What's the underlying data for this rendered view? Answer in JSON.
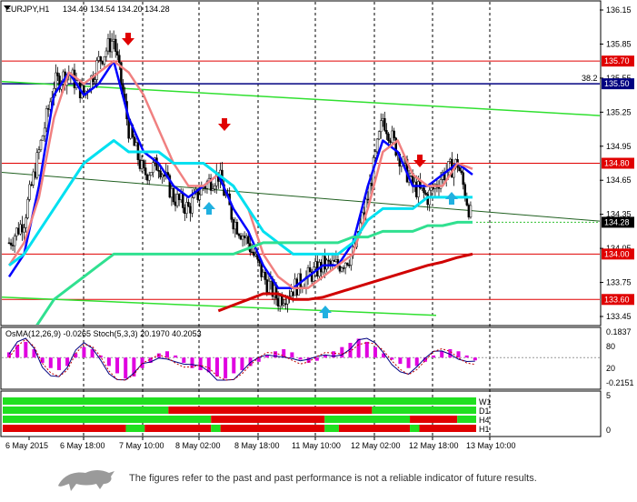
{
  "header": {
    "symbol": "EURJPY,H1",
    "ohlc": "134.49 134.54 134.20 134.28"
  },
  "colors": {
    "ma_fast": "#0000ff",
    "ma_mid": "#f08080",
    "ma_cyan": "#00e0f0",
    "ma_green": "#30e090",
    "ma_red": "#d00000",
    "trend": "#30e030",
    "level": "#e00000",
    "resistance": "#000080"
  },
  "chart_data": [
    {
      "type": "line",
      "ylim": [
        133.45,
        136.15
      ],
      "yticks": [
        "136.15",
        "135.85",
        "135.55",
        "135.25",
        "134.95",
        "134.65",
        "134.35",
        "134.05",
        "133.75",
        "133.45"
      ],
      "x": [
        "6 May 2015",
        "6 May 18:00",
        "7 May 10:00",
        "8 May 02:00",
        "8 May 18:00",
        "11 May 10:00",
        "12 May 02:00",
        "12 May 18:00",
        "13 May 10:00"
      ],
      "levels": [
        "135.70",
        "135.50",
        "134.80",
        "134.00",
        "133.60"
      ],
      "last_price": "134.28",
      "fib_label": "38.2",
      "series": [
        {
          "values": [
            134.1,
            134.3,
            134.9,
            135.5,
            135.6,
            135.4,
            135.7,
            135.9,
            135.1,
            134.7,
            134.8,
            134.5,
            134.4,
            134.6,
            134.7,
            134.3,
            134.1,
            133.8,
            133.6,
            133.7,
            133.8,
            133.9,
            133.9,
            134.0,
            134.5,
            135.2,
            134.9,
            134.6,
            134.5,
            134.7,
            134.8,
            134.28
          ]
        },
        {
          "values": [
            133.8,
            134.0,
            134.6,
            135.4,
            135.6,
            135.4,
            135.5,
            135.7,
            135.2,
            134.9,
            134.8,
            134.6,
            134.5,
            134.6,
            134.7,
            134.4,
            134.2,
            133.9,
            133.7,
            133.7,
            133.8,
            133.9,
            133.9,
            134.1,
            134.6,
            135.0,
            134.9,
            134.6,
            134.6,
            134.7,
            134.8,
            134.7
          ]
        },
        {
          "values": [
            133.9,
            134.1,
            134.5,
            135.2,
            135.6,
            135.5,
            135.6,
            135.7,
            135.6,
            135.4,
            135.1,
            134.8,
            134.6,
            134.6,
            134.7,
            134.6,
            134.4,
            134.0,
            133.8,
            133.7,
            133.7,
            133.8,
            133.9,
            134.0,
            134.4,
            134.9,
            135.0,
            134.7,
            134.6,
            134.6,
            134.8,
            134.75
          ]
        },
        {
          "values": [
            133.9,
            134.0,
            134.2,
            134.4,
            134.6,
            134.8,
            134.9,
            135.0,
            134.9,
            134.9,
            134.9,
            134.8,
            134.8,
            134.8,
            134.7,
            134.6,
            134.4,
            134.2,
            134.1,
            134.0,
            134.0,
            134.0,
            134.0,
            134.1,
            134.3,
            134.4,
            134.4,
            134.4,
            134.5,
            134.5,
            134.5,
            134.5
          ]
        },
        {
          "values": [
            133.0,
            133.2,
            133.4,
            133.6,
            133.7,
            133.8,
            133.9,
            134.0,
            134.0,
            134.0,
            134.0,
            134.0,
            134.0,
            134.0,
            134.0,
            134.0,
            134.05,
            134.1,
            134.1,
            134.1,
            134.1,
            134.1,
            134.1,
            134.15,
            134.15,
            134.2,
            134.2,
            134.2,
            134.25,
            134.25,
            134.28,
            134.28
          ]
        },
        {
          "values": [
            null,
            null,
            null,
            null,
            null,
            null,
            null,
            null,
            null,
            null,
            null,
            null,
            null,
            null,
            133.5,
            133.55,
            133.6,
            133.65,
            133.65,
            133.6,
            133.6,
            133.62,
            133.66,
            133.7,
            133.74,
            133.78,
            133.82,
            133.86,
            133.9,
            133.93,
            133.97,
            134.0
          ]
        }
      ]
    },
    {
      "type": "bar",
      "title": "OsMA(12,26,9) -0.0265  Stoch(5,3,3) 20.1970 40.2053",
      "yticks": [
        "0.1837",
        "80",
        "20",
        "-0.2151"
      ],
      "values": [
        0.05,
        0.12,
        0.15,
        0.08,
        -0.05,
        -0.1,
        -0.12,
        -0.08,
        0.04,
        0.1,
        0.08,
        0.02,
        -0.08,
        -0.15,
        -0.2,
        -0.18,
        -0.1,
        -0.05,
        0.04,
        0.06,
        0.02,
        -0.05,
        -0.1,
        -0.12,
        -0.14,
        -0.18,
        -0.2,
        -0.15,
        -0.12,
        -0.08,
        -0.04,
        0.02,
        0.06,
        0.08,
        0.05,
        -0.02,
        -0.05,
        -0.03,
        0.02,
        0.06,
        0.1,
        0.14,
        0.18,
        0.15,
        0.1,
        0.04,
        -0.02,
        -0.06,
        -0.1,
        -0.08,
        -0.04,
        0.02,
        0.06,
        0.08,
        0.06,
        0.02,
        -0.0265
      ]
    },
    {
      "type": "heatmap",
      "yticks": [
        "5",
        "0"
      ],
      "rows": [
        {
          "name": "W1",
          "segments": [
            {
              "from": 0,
              "to": 1,
              "state": "up"
            }
          ]
        },
        {
          "name": "D1",
          "segments": [
            {
              "from": 0,
              "to": 0.35,
              "state": "up"
            },
            {
              "from": 0.35,
              "to": 0.78,
              "state": "down"
            },
            {
              "from": 0.78,
              "to": 1,
              "state": "up"
            }
          ]
        },
        {
          "name": "H4",
          "segments": [
            {
              "from": 0,
              "to": 0.44,
              "state": "up"
            },
            {
              "from": 0.44,
              "to": 0.68,
              "state": "down"
            },
            {
              "from": 0.68,
              "to": 0.86,
              "state": "up"
            },
            {
              "from": 0.86,
              "to": 0.96,
              "state": "down"
            },
            {
              "from": 0.96,
              "to": 1,
              "state": "up"
            }
          ]
        },
        {
          "name": "H1",
          "segments": [
            {
              "from": 0,
              "to": 0.26,
              "state": "down"
            },
            {
              "from": 0.26,
              "to": 0.3,
              "state": "up"
            },
            {
              "from": 0.3,
              "to": 0.44,
              "state": "down"
            },
            {
              "from": 0.44,
              "to": 0.46,
              "state": "up"
            },
            {
              "from": 0.46,
              "to": 0.68,
              "state": "down"
            },
            {
              "from": 0.68,
              "to": 0.71,
              "state": "up"
            },
            {
              "from": 0.71,
              "to": 0.86,
              "state": "down"
            },
            {
              "from": 0.86,
              "to": 0.88,
              "state": "up"
            },
            {
              "from": 0.88,
              "to": 1,
              "state": "down"
            }
          ]
        }
      ]
    }
  ],
  "footer": {
    "disclaimer": "The figures refer to the past and past performance is not a reliable indicator of future results."
  }
}
